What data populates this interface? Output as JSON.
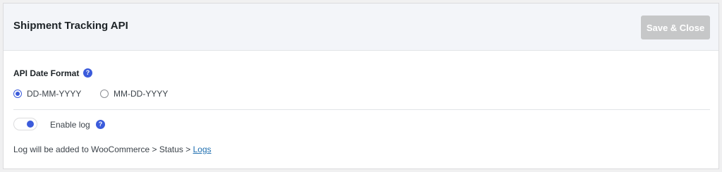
{
  "header": {
    "title": "Shipment Tracking API",
    "save_label": "Save & Close"
  },
  "date_format": {
    "label": "API Date Format",
    "options": [
      {
        "label": "DD-MM-YYYY",
        "checked": true
      },
      {
        "label": "MM-DD-YYYY",
        "checked": false
      }
    ]
  },
  "log": {
    "toggle_label": "Enable log",
    "enabled": true,
    "note_prefix": "Log will be added to WooCommerce > Status > ",
    "note_link": "Logs"
  },
  "icons": {
    "help": "?"
  },
  "colors": {
    "accent": "#3b5bdb",
    "link": "#2271b1",
    "save_button_disabled": "#c6c7c8"
  }
}
